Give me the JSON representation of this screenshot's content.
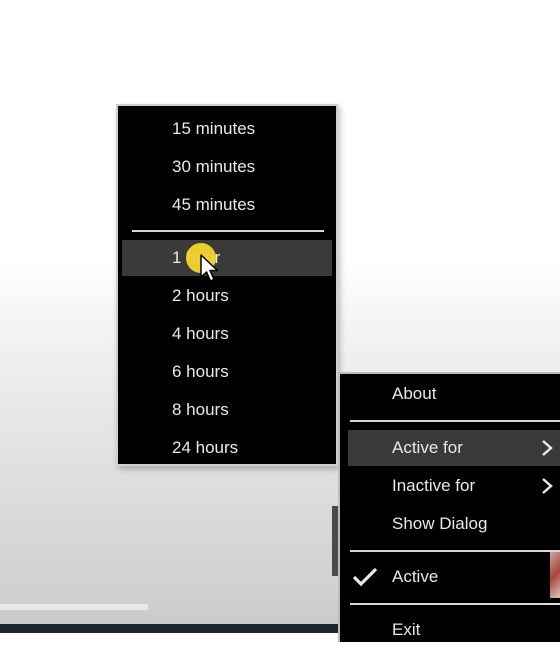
{
  "duration_submenu": {
    "items": [
      {
        "label": "15 minutes"
      },
      {
        "label": "30 minutes"
      },
      {
        "label": "45 minutes"
      },
      {
        "label": "1 hour"
      },
      {
        "label": "2 hours"
      },
      {
        "label": "4 hours"
      },
      {
        "label": "6 hours"
      },
      {
        "label": "8 hours"
      },
      {
        "label": "24 hours"
      }
    ],
    "highlighted": "1 hour"
  },
  "context_menu": {
    "about": "About",
    "active_for": "Active for",
    "inactive_for": "Inactive for",
    "show_dialog": "Show Dialog",
    "active": "Active",
    "exit": "Exit",
    "active_checked": true
  },
  "icons": {
    "submenu_arrow": "chevron-right-icon",
    "checked": "checkmark-icon",
    "cursor": "mouse-pointer-icon"
  },
  "colors": {
    "menu_bg": "#000000",
    "menu_text": "#e9e9e9",
    "highlight_bg": "#3a3a3a",
    "cursor_highlight": "#f1d52b"
  }
}
